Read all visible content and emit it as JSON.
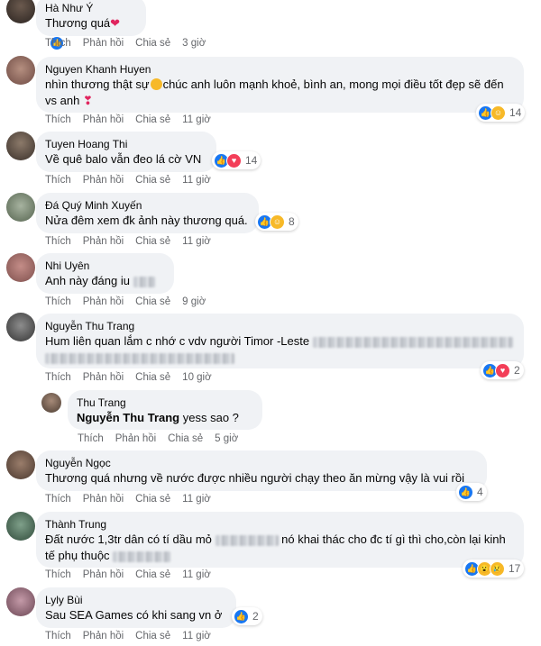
{
  "actions": {
    "like": "Thích",
    "reply": "Phản hồi",
    "share": "Chia sẻ"
  },
  "comments": [
    {
      "author": "Hà Như Ý",
      "text": "Thương quá",
      "time": "3 giờ"
    },
    {
      "author": "Nguyen Khanh Huyen",
      "text1": "nhìn thương thật sự",
      "text2": "chúc anh luôn mạnh khoẻ, bình an, mong mọi điều tốt đẹp sẽ đến",
      "text3": "vs anh",
      "time": "11 giờ",
      "reactions": "14"
    },
    {
      "author": "Tuyen Hoang Thi",
      "text": "Về quê balo vẫn đeo lá cờ VN",
      "time": "11 giờ",
      "reactions": "14"
    },
    {
      "author": "Đá Quý Minh Xuyến",
      "text": "Nửa đêm xem đk ảnh này thương quá.",
      "time": "11 giờ",
      "reactions": "8"
    },
    {
      "author": "Nhi Uyên",
      "text": "Anh này đáng iu",
      "time": "9 giờ"
    },
    {
      "author": "Nguyễn Thu Trang",
      "text": "Hum liên quan lắm c nhớ c vdv người Timor -Leste",
      "time": "10 giờ",
      "reactions": "2"
    },
    {
      "author": "Thu Trang",
      "mention": "Nguyễn Thu Trang",
      "text": "yess sao ?",
      "time": "5 giờ"
    },
    {
      "author": "Nguyễn Ngọc",
      "text": "Thương quá nhưng về nước được nhiều người chạy theo ăn mừng vậy là vui rồi",
      "time": "11 giờ",
      "reactions": "4"
    },
    {
      "author": "Thành Trung",
      "text1": "Đất nước 1,3tr dân có tí dầu mỏ",
      "text2": "nó khai thác cho đc tí gì thì cho,còn lại kinh",
      "text3": "tế phụ thuộc",
      "time": "11 giờ",
      "reactions": "17"
    },
    {
      "author": "Lyly Bùi",
      "text": "Sau SEA Games có khi sang vn ở",
      "time": "11 giờ",
      "reactions": "2"
    }
  ],
  "colors": {
    "bubble": "#f0f2f5",
    "meta": "#65676b",
    "like": "#1877f2",
    "love": "#f33e58"
  }
}
